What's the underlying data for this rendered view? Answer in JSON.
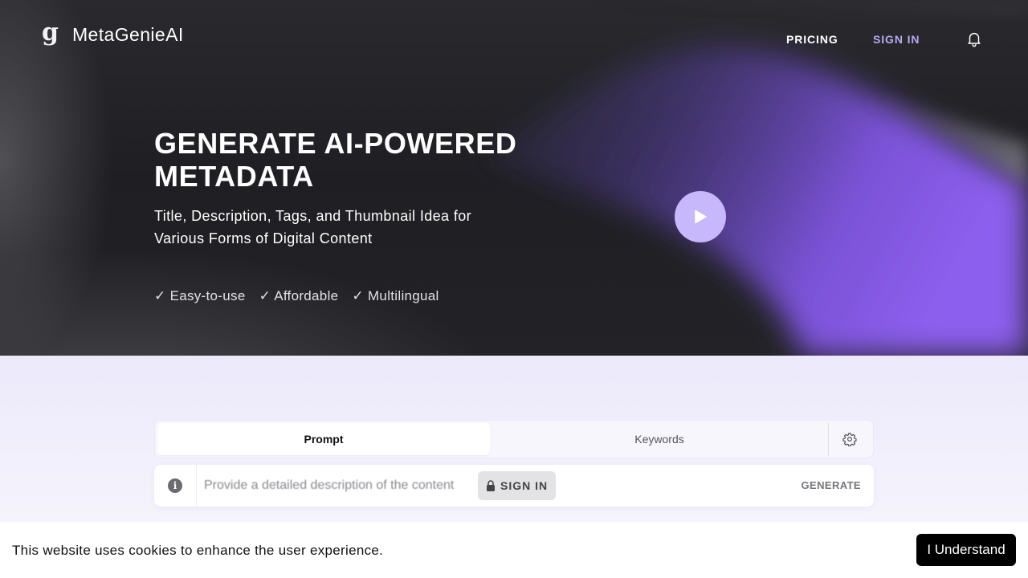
{
  "brand": {
    "logo_mark": "g",
    "name": "MetaGenieAI"
  },
  "nav": {
    "pricing": "PRICING",
    "sign_in": "SIGN IN"
  },
  "hero": {
    "headline": "GENERATE AI-POWERED METADATA",
    "subline": "Title, Description, Tags, and Thumbnail Idea for Various Forms of Digital Content",
    "features": [
      "✓ Easy-to-use",
      "✓ Affordable",
      "✓ Multilingual"
    ]
  },
  "tabs": {
    "prompt": "Prompt",
    "keywords": "Keywords"
  },
  "input": {
    "info_glyph": "i",
    "placeholder": "Provide a detailed description of the content",
    "sign_in_chip": "SIGN IN",
    "generate": "GENERATE"
  },
  "cookie": {
    "message": "This website uses cookies to enhance the user experience.",
    "accept": "I Understand"
  },
  "colors": {
    "accent": "#8a5cf0",
    "play_button": "#c7b7fb",
    "sign_in_link": "#b9a7f3"
  },
  "icons": [
    "bell-icon",
    "play-icon",
    "gear-icon",
    "info-icon",
    "lock-icon"
  ]
}
